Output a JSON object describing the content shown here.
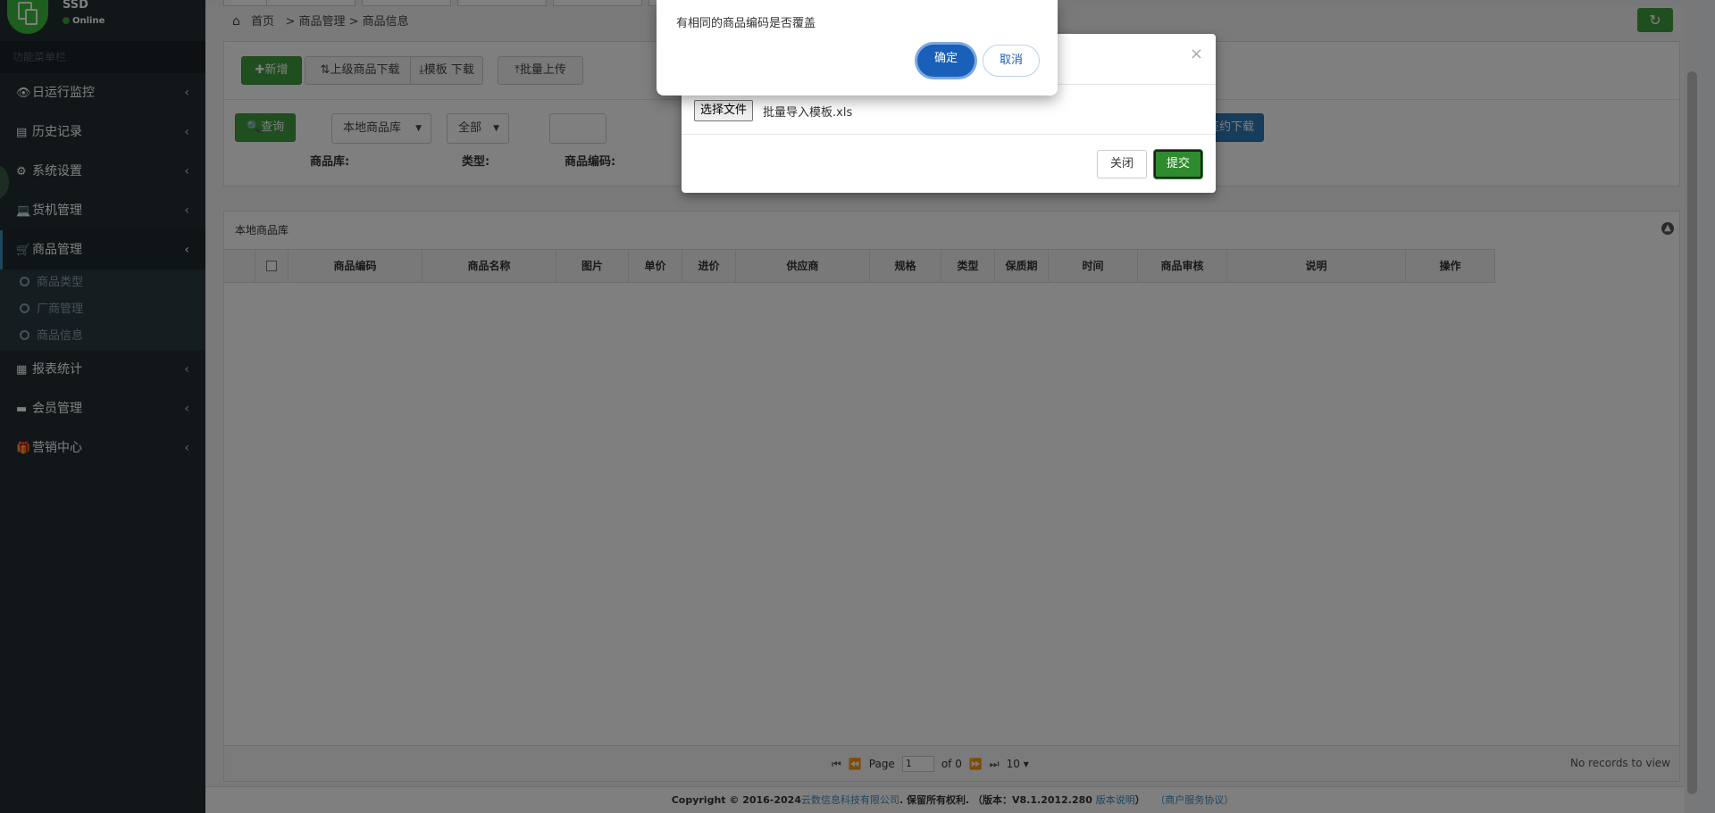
{
  "user": {
    "name": "SSD",
    "status": "Online"
  },
  "sidebar": {
    "header": "功能菜单栏",
    "items": [
      {
        "label": "日运行监控",
        "icon": "eye-icon",
        "glyph": "👁"
      },
      {
        "label": "历史记录",
        "icon": "book-icon",
        "glyph": "▤"
      },
      {
        "label": "系统设置",
        "icon": "gear-icon",
        "glyph": "⚙"
      },
      {
        "label": "货机管理",
        "icon": "laptop-icon",
        "glyph": "💻"
      },
      {
        "label": "商品管理",
        "icon": "cart-icon",
        "glyph": "🛒"
      },
      {
        "label": "报表统计",
        "icon": "table-icon",
        "glyph": "▦"
      },
      {
        "label": "会员管理",
        "icon": "card-icon",
        "glyph": "▬"
      },
      {
        "label": "营销中心",
        "icon": "gift-icon",
        "glyph": "🎁"
      }
    ],
    "submenu": [
      "商品类型",
      "厂商管理",
      "商品信息"
    ]
  },
  "breadcrumb": {
    "home": "首页",
    "path": "> 商品管理 > 商品信息"
  },
  "toolbar": {
    "add": "✚新增",
    "download_upper": "上级商品下载",
    "template_download": "模板 下载",
    "batch_upload": "批量上传",
    "query": "🔍查询",
    "library_select": "本地商品库",
    "type_select": "全部",
    "contract_download": "签约下载"
  },
  "filters": {
    "library": "商品库:",
    "type": "类型:",
    "code": "商品编码:"
  },
  "grid": {
    "title": "本地商品库",
    "columns": [
      "商品编码",
      "商品名称",
      "图片",
      "单价",
      "进价",
      "供应商",
      "规格",
      "类型",
      "保质期",
      "时间",
      "商品审核",
      "说明",
      "操作"
    ],
    "pager": {
      "page_label": "Page",
      "page": "1",
      "of": "of 0",
      "size": "10"
    },
    "empty": "No records to view"
  },
  "footer": {
    "copyright": "Copyright © 2016-2024",
    "company": "云数信息科技有限公司",
    "rights": ". 保留所有权利.  （版本：V8.1.2012.280",
    "version_link": "版本说明",
    "close_paren": "）",
    "agreement": "（商户服务协议）"
  },
  "modal": {
    "file_button": "选择文件",
    "file_name": "批量导入模板.xls",
    "close": "关闭",
    "submit": "提交"
  },
  "confirm": {
    "message": "有相同的商品编码是否覆盖",
    "ok": "确定",
    "cancel": "取消"
  },
  "colors": {
    "sidebar": "#222d32",
    "green": "#3f9c3f",
    "blue": "#2f7ab8",
    "confirm_blue": "#1a5fb8"
  }
}
